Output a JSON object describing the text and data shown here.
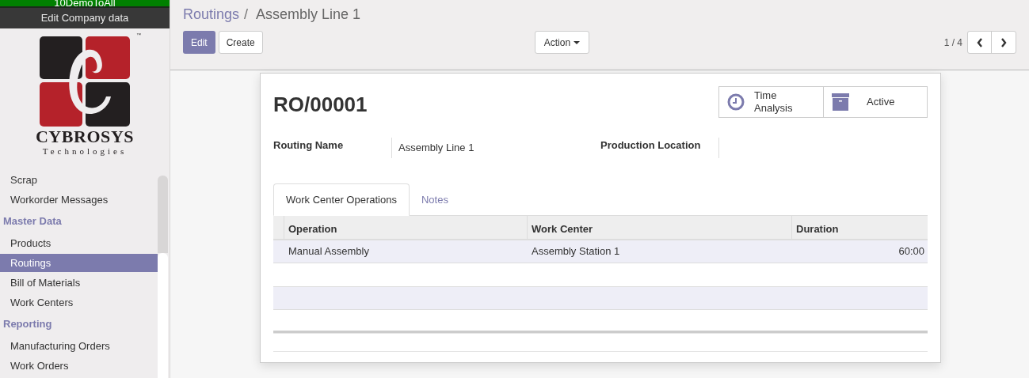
{
  "sidebar": {
    "top_banner": "10DemoToAll",
    "company_button": "Edit Company data",
    "logo": {
      "name": "CYBROSYS",
      "tagline": "Technologies",
      "mark": "™"
    },
    "menu": [
      {
        "kind": "item",
        "label": "Scrap",
        "selected": false
      },
      {
        "kind": "item",
        "label": "Workorder Messages",
        "selected": false
      },
      {
        "kind": "section",
        "label": "Master Data"
      },
      {
        "kind": "item",
        "label": "Products",
        "selected": false
      },
      {
        "kind": "item",
        "label": "Routings",
        "selected": true
      },
      {
        "kind": "item",
        "label": "Bill of Materials",
        "selected": false
      },
      {
        "kind": "item",
        "label": "Work Centers",
        "selected": false
      },
      {
        "kind": "section",
        "label": "Reporting"
      },
      {
        "kind": "item",
        "label": "Manufacturing Orders",
        "selected": false
      },
      {
        "kind": "item",
        "label": "Work Orders",
        "selected": false
      }
    ]
  },
  "breadcrumb": {
    "parent": "Routings",
    "separator": "/",
    "current": "Assembly Line 1"
  },
  "buttons": {
    "edit": "Edit",
    "create": "Create",
    "action": "Action"
  },
  "pager": "1 / 4",
  "record": {
    "reference": "RO/00001",
    "smart_buttons": [
      {
        "kind": "clock",
        "label_lines": [
          "Time",
          "Analysis"
        ]
      },
      {
        "kind": "archive",
        "label_lines": [
          "Active"
        ]
      }
    ],
    "fields": [
      {
        "label": "Routing Name",
        "value": "Assembly Line 1"
      },
      {
        "label": "Production Location"
      }
    ],
    "tabs": [
      {
        "label": "Work Center Operations",
        "selected": true
      },
      {
        "label": "Notes",
        "selected": false
      }
    ],
    "table": {
      "columns": [
        "Operation",
        "Work Center",
        "Duration"
      ],
      "rows": [
        [
          "Manual Assembly",
          "Assembly Station 1",
          "60:00"
        ]
      ]
    }
  }
}
